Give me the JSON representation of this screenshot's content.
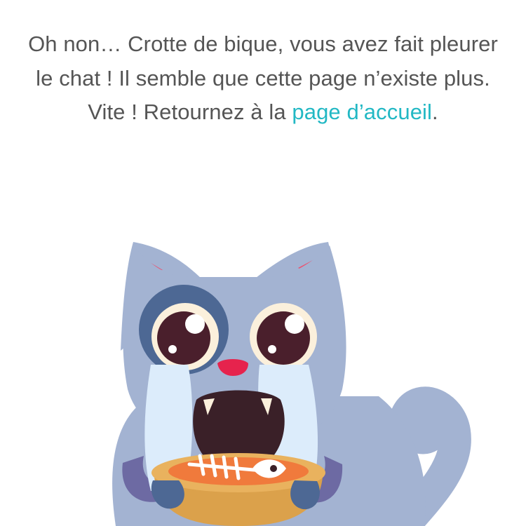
{
  "error_page": {
    "message_before_link": "Oh non… Crotte de bique, vous avez fait pleurer le chat ! Il semble que cette page n’existe plus. Vite ! Retournez à la ",
    "home_link_label": "page d’accueil",
    "message_after_link": ".",
    "link_color": "#22b8c4",
    "text_color": "#555555"
  },
  "illustration": {
    "icon": "crying-cat-icon",
    "cat_color": "#a3b3d2",
    "holding": "fish-bowl-icon"
  }
}
